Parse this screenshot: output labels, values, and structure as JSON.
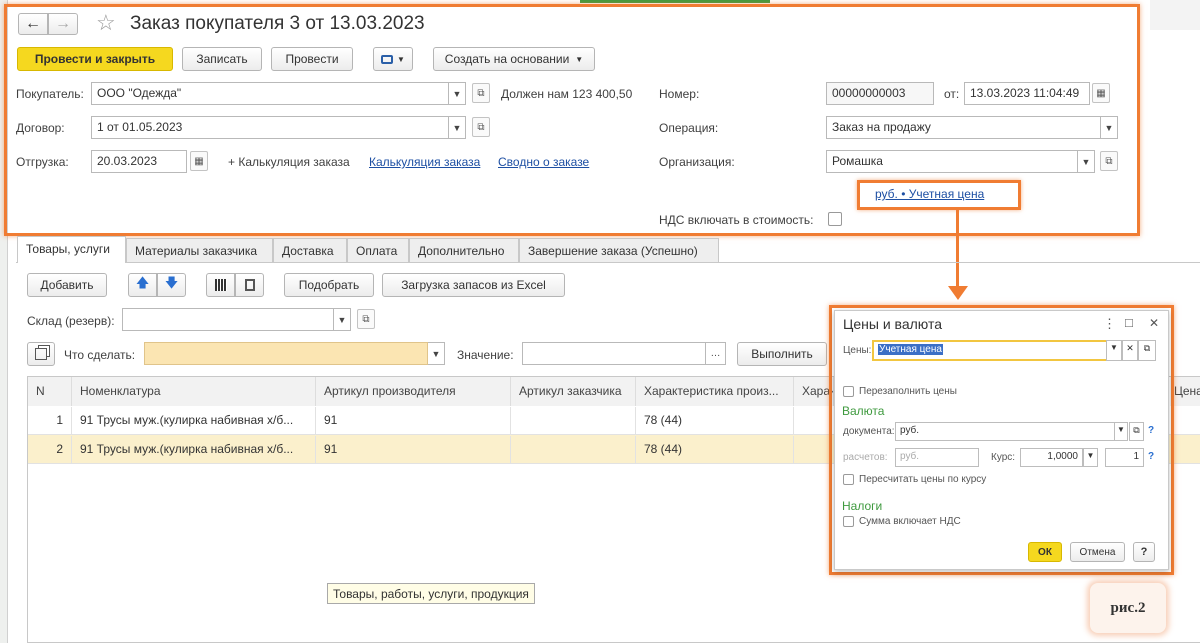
{
  "window": {
    "title": "Заказ покупателя 3 от 13.03.2023",
    "nav_back": "←",
    "nav_forward": "→",
    "favorite_star": "☆"
  },
  "toolbar": {
    "post_and_close": "Провести и закрыть",
    "save": "Записать",
    "post": "Провести",
    "print_icon": "printer-icon",
    "create_based_on": "Создать на основании"
  },
  "header": {
    "customer_label": "Покупатель:",
    "customer_value": "ООО \"Одежда\"",
    "debt_text": "Должен нам 123 400,50",
    "number_label": "Номер:",
    "number_value": "00000000003",
    "date_label": "от:",
    "date_value": "13.03.2023 11:04:49",
    "contract_label": "Договор:",
    "contract_value": "1 от 01.05.2023",
    "operation_label": "Операция:",
    "operation_value": "Заказ на продажу",
    "shipment_label": "Отгрузка:",
    "shipment_value": "20.03.2023",
    "calc_plus": "+ Калькуляция заказа",
    "calc_link": "Калькуляция заказа",
    "summary_link": "Сводно о заказе",
    "organization_label": "Организация:",
    "organization_value": "Ромашка",
    "price_currency_link": "руб. • Учетная цена",
    "vat_label": "НДС включать в стоимость:"
  },
  "tabs": [
    {
      "label": "Товары, услуги"
    },
    {
      "label": "Материалы заказчика"
    },
    {
      "label": "Доставка"
    },
    {
      "label": "Оплата"
    },
    {
      "label": "Дополнительно"
    },
    {
      "label": "Завершение заказа (Успешно)"
    }
  ],
  "goods": {
    "add": "Добавить",
    "pick": "Подобрать",
    "load_excel": "Загрузка запасов из Excel",
    "warehouse_label": "Склад (резерв):",
    "what_to_do_label": "Что сделать:",
    "value_label": "Значение:",
    "execute": "Выполнить",
    "columns": [
      "N",
      "Номенклатура",
      "Артикул производителя",
      "Артикул заказчика",
      "Характеристика произ...",
      "Харак",
      "Цена"
    ],
    "rows": [
      {
        "n": "1",
        "item": "91 Трусы муж.(кулирка набивная х/б...",
        "mfr_article": "91",
        "cust_article": "",
        "char": "78 (44)"
      },
      {
        "n": "2",
        "item": "91 Трусы муж.(кулирка набивная х/б...",
        "mfr_article": "91",
        "cust_article": "",
        "char": "78 (44)"
      }
    ],
    "tooltip": "Товары, работы, услуги, продукция"
  },
  "dialog": {
    "title": "Цены и валюта",
    "more_icon": "⋮",
    "maximize_icon": "□",
    "close_icon": "✕",
    "prices_label": "Цены:",
    "prices_value": "Учетная цена",
    "refill_prices": "Перезаполнить цены",
    "currency_section": "Валюта",
    "document_label": "документа:",
    "document_value": "руб.",
    "settlements_label": "расчетов:",
    "settlements_value": "руб.",
    "rate_label": "Курс:",
    "rate_value": "1,0000",
    "multiplier_value": "1",
    "recalc_by_rate": "Пересчитать цены по курсу",
    "taxes_section": "Налоги",
    "sum_includes_vat": "Сумма включает НДС",
    "ok": "ОК",
    "cancel": "Отмена",
    "help": "?"
  },
  "figure_label": "рис.2",
  "colors": {
    "highlight_orange": "#f07c32",
    "primary_yellow": "#f5d81f",
    "link_blue": "#1d4fa3",
    "section_green": "#3f9a3f",
    "selected_row": "#fbf0cc"
  }
}
